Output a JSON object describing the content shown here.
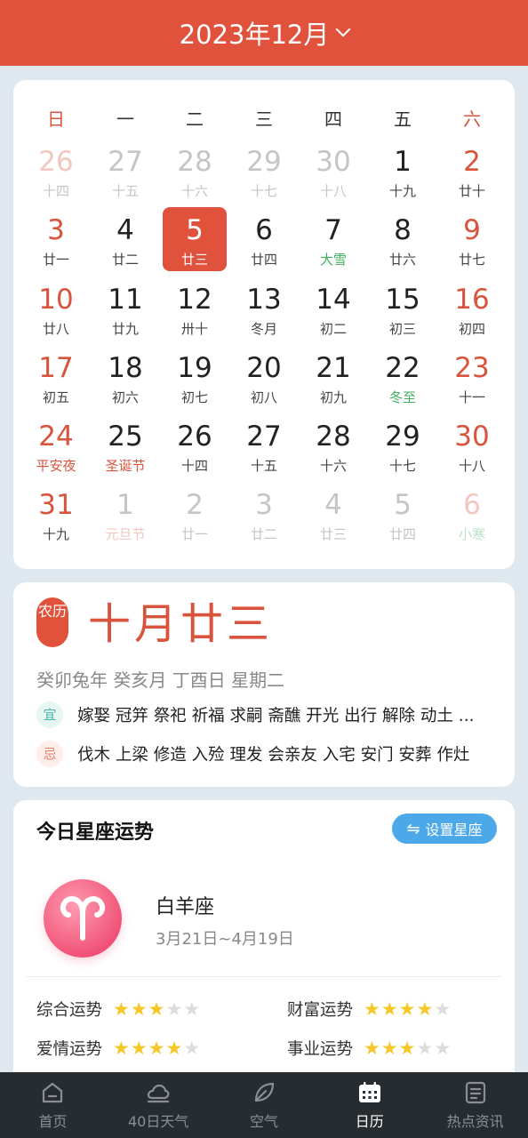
{
  "header": {
    "title": "2023年12月"
  },
  "weekdays": [
    "日",
    "一",
    "二",
    "三",
    "四",
    "五",
    "六"
  ],
  "calendar": {
    "weeks": [
      [
        {
          "d": "26",
          "l": "十四"
        },
        {
          "d": "27",
          "l": "十五"
        },
        {
          "d": "28",
          "l": "十六"
        },
        {
          "d": "29",
          "l": "十七"
        },
        {
          "d": "30",
          "l": "十八"
        },
        {
          "d": "1",
          "l": "十九"
        },
        {
          "d": "2",
          "l": "廿十"
        }
      ],
      [
        {
          "d": "3",
          "l": "廿一"
        },
        {
          "d": "4",
          "l": "廿二"
        },
        {
          "d": "5",
          "l": "廿三"
        },
        {
          "d": "6",
          "l": "廿四"
        },
        {
          "d": "7",
          "l": "大雪"
        },
        {
          "d": "8",
          "l": "廿六"
        },
        {
          "d": "9",
          "l": "廿七"
        }
      ],
      [
        {
          "d": "10",
          "l": "廿八"
        },
        {
          "d": "11",
          "l": "廿九"
        },
        {
          "d": "12",
          "l": "卅十"
        },
        {
          "d": "13",
          "l": "冬月"
        },
        {
          "d": "14",
          "l": "初二"
        },
        {
          "d": "15",
          "l": "初三"
        },
        {
          "d": "16",
          "l": "初四"
        }
      ],
      [
        {
          "d": "17",
          "l": "初五"
        },
        {
          "d": "18",
          "l": "初六"
        },
        {
          "d": "19",
          "l": "初七"
        },
        {
          "d": "20",
          "l": "初八"
        },
        {
          "d": "21",
          "l": "初九"
        },
        {
          "d": "22",
          "l": "冬至"
        },
        {
          "d": "23",
          "l": "十一"
        }
      ],
      [
        {
          "d": "24",
          "l": "平安夜"
        },
        {
          "d": "25",
          "l": "圣诞节"
        },
        {
          "d": "26",
          "l": "十四"
        },
        {
          "d": "27",
          "l": "十五"
        },
        {
          "d": "28",
          "l": "十六"
        },
        {
          "d": "29",
          "l": "十七"
        },
        {
          "d": "30",
          "l": "十八"
        }
      ],
      [
        {
          "d": "31",
          "l": "十九"
        },
        {
          "d": "1",
          "l": "元旦节"
        },
        {
          "d": "2",
          "l": "廿一"
        },
        {
          "d": "3",
          "l": "廿二"
        },
        {
          "d": "4",
          "l": "廿三"
        },
        {
          "d": "5",
          "l": "廿四"
        },
        {
          "d": "6",
          "l": "小寒"
        }
      ]
    ]
  },
  "lunar": {
    "badge": "农历",
    "date": "十月廿三",
    "ganzhi": "癸卯兔年 癸亥月 丁酉日 星期二",
    "yi_label": "宜",
    "yi": "嫁娶 冠笄 祭祀 祈福 求嗣 斋醮 开光 出行 解除 动土 ...",
    "ji_label": "忌",
    "ji": "伐木 上梁 修造 入殓 理发 会亲友 入宅 安门 安葬 作灶"
  },
  "horoscope": {
    "title": "今日星座运势",
    "set_button": "设置星座",
    "sign_name": "白羊座",
    "sign_dates": "3月21日~4月19日",
    "fortunes": [
      {
        "label": "综合运势",
        "stars": 3,
        "max": 5
      },
      {
        "label": "财富运势",
        "stars": 4,
        "max": 5
      },
      {
        "label": "爱情运势",
        "stars": 4,
        "max": 5
      },
      {
        "label": "事业运势",
        "stars": 3,
        "max": 5
      }
    ]
  },
  "nav": [
    {
      "label": "首页",
      "icon": "home-icon"
    },
    {
      "label": "40日天气",
      "icon": "cloud-icon"
    },
    {
      "label": "空气",
      "icon": "leaf-icon"
    },
    {
      "label": "日历",
      "icon": "calendar-icon"
    },
    {
      "label": "热点资讯",
      "icon": "news-icon"
    }
  ],
  "colors": {
    "accent": "#e0523b",
    "solar_term": "#3fae5d",
    "star": "#f6c726",
    "button": "#4da8ea",
    "navbar": "#272c31"
  }
}
